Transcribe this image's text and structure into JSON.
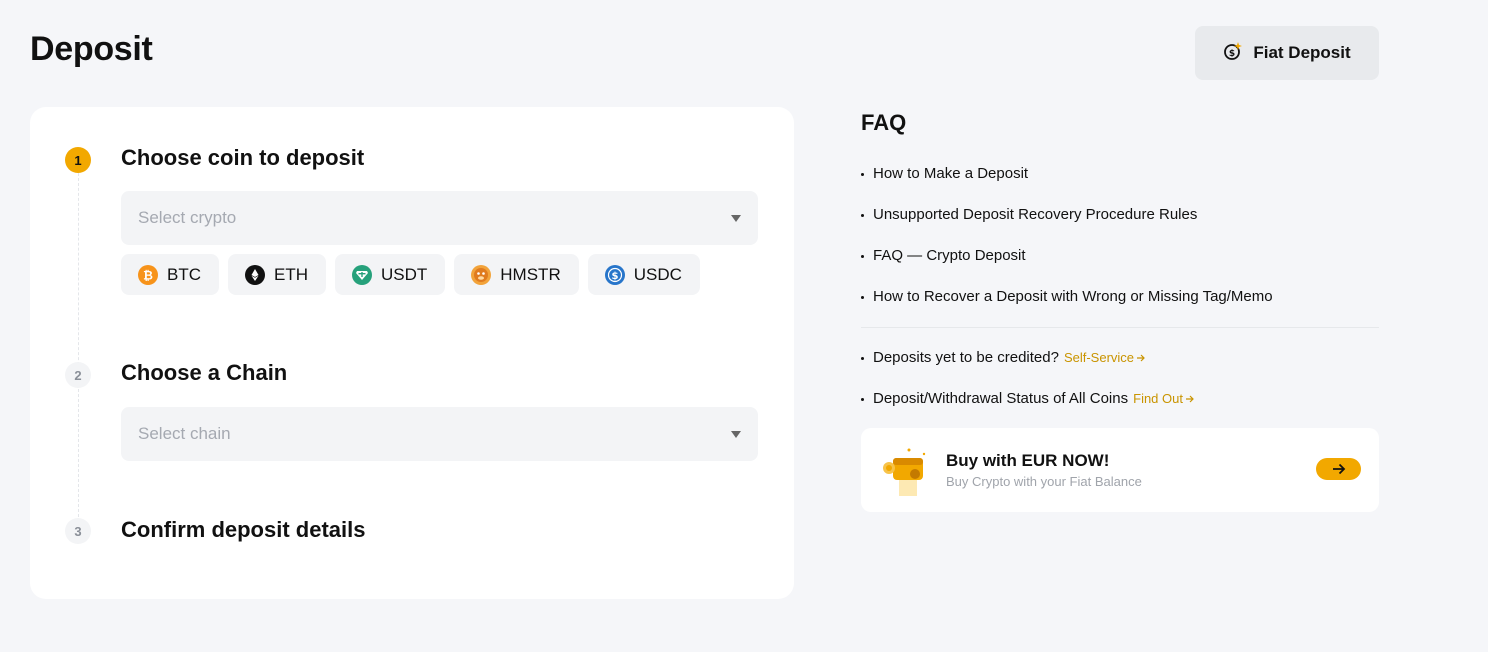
{
  "header": {
    "title": "Deposit",
    "fiat_button_label": "Fiat Deposit"
  },
  "steps": [
    {
      "number": "1",
      "title": "Choose coin to deposit",
      "placeholder": "Select crypto"
    },
    {
      "number": "2",
      "title": "Choose a Chain",
      "placeholder": "Select chain"
    },
    {
      "number": "3",
      "title": "Confirm deposit details"
    }
  ],
  "coins": [
    {
      "symbol": "BTC",
      "icon": "bitcoin-icon",
      "color": "#f7931a"
    },
    {
      "symbol": "ETH",
      "icon": "ethereum-icon",
      "color": "#111111"
    },
    {
      "symbol": "USDT",
      "icon": "tether-icon",
      "color": "#26a17b"
    },
    {
      "symbol": "HMSTR",
      "icon": "hamster-icon",
      "color": "#f2a33a"
    },
    {
      "symbol": "USDC",
      "icon": "usdc-icon",
      "color": "#2775ca"
    }
  ],
  "faq": {
    "title": "FAQ",
    "items": [
      "How to Make a Deposit",
      "Unsupported Deposit Recovery Procedure Rules",
      "FAQ — Crypto Deposit",
      "How to Recover a Deposit with Wrong or Missing Tag/Memo"
    ],
    "extra": [
      {
        "text": "Deposits yet to be credited?",
        "link": "Self-Service"
      },
      {
        "text": "Deposit/Withdrawal Status of All Coins",
        "link": "Find Out"
      }
    ]
  },
  "promo": {
    "title": "Buy with EUR NOW!",
    "subtitle": "Buy Crypto with your Fiat Balance"
  },
  "colors": {
    "accent": "#f2a800",
    "link": "#c99400",
    "background": "#f5f6f9"
  }
}
